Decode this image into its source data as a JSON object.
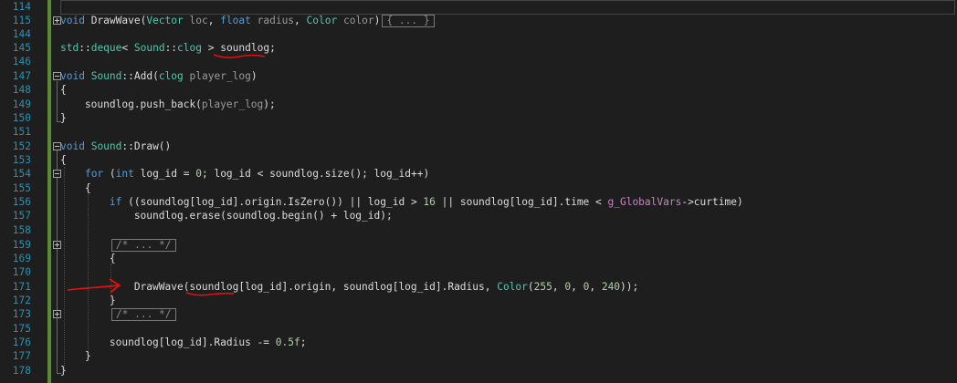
{
  "editor": {
    "lines": [
      {
        "num": "114",
        "code": ""
      },
      {
        "num": "115",
        "code": "void DrawWave(Vector loc, float radius, Color color)",
        "collapsed": "{ ... }"
      },
      {
        "num": "144",
        "code": ""
      },
      {
        "num": "145",
        "code": "std::deque< Sound::clog > soundlog;"
      },
      {
        "num": "146",
        "code": ""
      },
      {
        "num": "147",
        "code": "void Sound::Add(clog player_log)"
      },
      {
        "num": "148",
        "code": "{"
      },
      {
        "num": "149",
        "code": "    soundlog.push_back(player_log);"
      },
      {
        "num": "150",
        "code": "}"
      },
      {
        "num": "151",
        "code": ""
      },
      {
        "num": "152",
        "code": "void Sound::Draw()"
      },
      {
        "num": "153",
        "code": "{"
      },
      {
        "num": "154",
        "code": "    for (int log_id = 0; log_id < soundlog.size(); log_id++)"
      },
      {
        "num": "155",
        "code": "    {"
      },
      {
        "num": "156",
        "code": "        if ((soundlog[log_id].origin.IsZero()) || log_id > 16 || soundlog[log_id].time < g_GlobalVars->curtime)"
      },
      {
        "num": "157",
        "code": "            soundlog.erase(soundlog.begin() + log_id);"
      },
      {
        "num": "158",
        "code": ""
      },
      {
        "num": "159",
        "code": "",
        "collapsed": "/* ... */"
      },
      {
        "num": "169",
        "code": "        {"
      },
      {
        "num": "170",
        "code": ""
      },
      {
        "num": "171",
        "code": "            DrawWave(soundlog[log_id].origin, soundlog[log_id].Radius, Color(255, 0, 0, 240));"
      },
      {
        "num": "172",
        "code": "        }"
      },
      {
        "num": "173",
        "code": "",
        "collapsed": "/* ... */"
      },
      {
        "num": "175",
        "code": ""
      },
      {
        "num": "176",
        "code": "        soundlog[log_id].Radius -= 0.5f;"
      },
      {
        "num": "177",
        "code": "    }"
      },
      {
        "num": "178",
        "code": "}"
      }
    ]
  },
  "colors": {
    "background": "#1e1e1e",
    "line_number": "#2b91af",
    "keyword": "#569cd6",
    "type": "#4ec9b0",
    "change_bar": "#5a8a34",
    "annotation": "#e01010"
  }
}
